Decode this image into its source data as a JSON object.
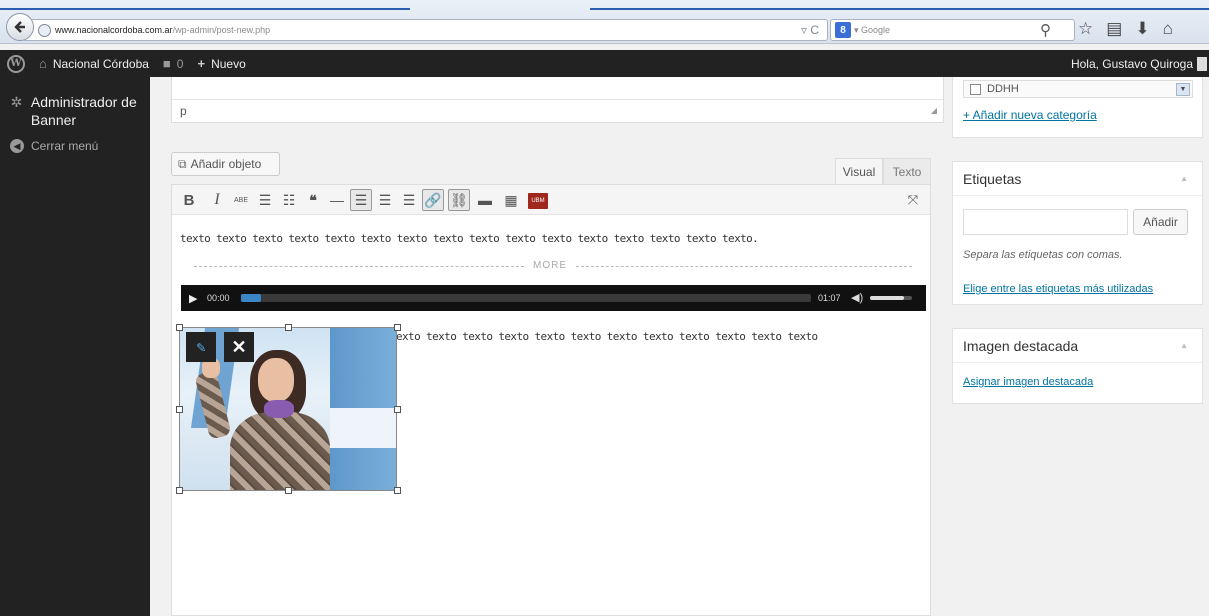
{
  "browser": {
    "url_domain": "www.nacionalcordoba.com.ar",
    "url_path": "/wp-admin/post-new.php",
    "url_icons": "▿ C",
    "search_engine_logo": "8",
    "search_placeholder": "▾ Google",
    "icons": [
      "back-icon",
      "search-icon",
      "star-icon",
      "bookmarks-icon",
      "download-icon",
      "home-icon"
    ]
  },
  "adminbar": {
    "site_name": "Nacional Córdoba",
    "comments_count": "0",
    "new_label": "Nuevo",
    "greeting": "Hola, Gustavo Quiroga"
  },
  "sidebar": {
    "items": [
      {
        "label": "Administrador de Banner",
        "icon": "gear-icon"
      }
    ],
    "collapse_label": "Cerrar menú"
  },
  "editor": {
    "excerpt_text": "p",
    "add_media_label": "Añadir objeto",
    "tabs": [
      {
        "label": "Visual",
        "active": true
      },
      {
        "label": "Texto",
        "active": false
      }
    ],
    "toolbar": {
      "bold": "B",
      "italic": "I",
      "strike": "ABE",
      "bullets": "☰",
      "numbers": "☷",
      "quote": "❝",
      "hr": "—",
      "align_left": "☰",
      "align_center": "☰",
      "align_right": "☰",
      "link": "🔗",
      "unlink": "⛓",
      "more": "▬",
      "kitchen_sink": "▦",
      "ubm": "UBM",
      "fullscreen": "⤧"
    },
    "paragraph1": "texto texto texto texto texto texto texto texto texto texto texto texto texto texto texto texto.",
    "more_label": "MORE",
    "audio": {
      "current_time": "00:00",
      "duration": "01:07",
      "progress": 0.03,
      "volume": 0.8
    },
    "paragraph2": "exto texto texto texto texto texto texto texto texto texto texto texto"
  },
  "categories": {
    "visible_item": "DDHH",
    "add_link": "+ Añadir nueva categoría"
  },
  "tags": {
    "title": "Etiquetas",
    "input_value": "",
    "add_button": "Añadir",
    "hint": "Separa las etiquetas con comas.",
    "cloud_link": "Elige entre las etiquetas más utilizadas"
  },
  "featured_image": {
    "title": "Imagen destacada",
    "link": "Asignar imagen destacada"
  },
  "colors": {
    "admin_dark": "#222222",
    "link_blue": "#0074a2",
    "audio_progress": "#3b86c7"
  }
}
